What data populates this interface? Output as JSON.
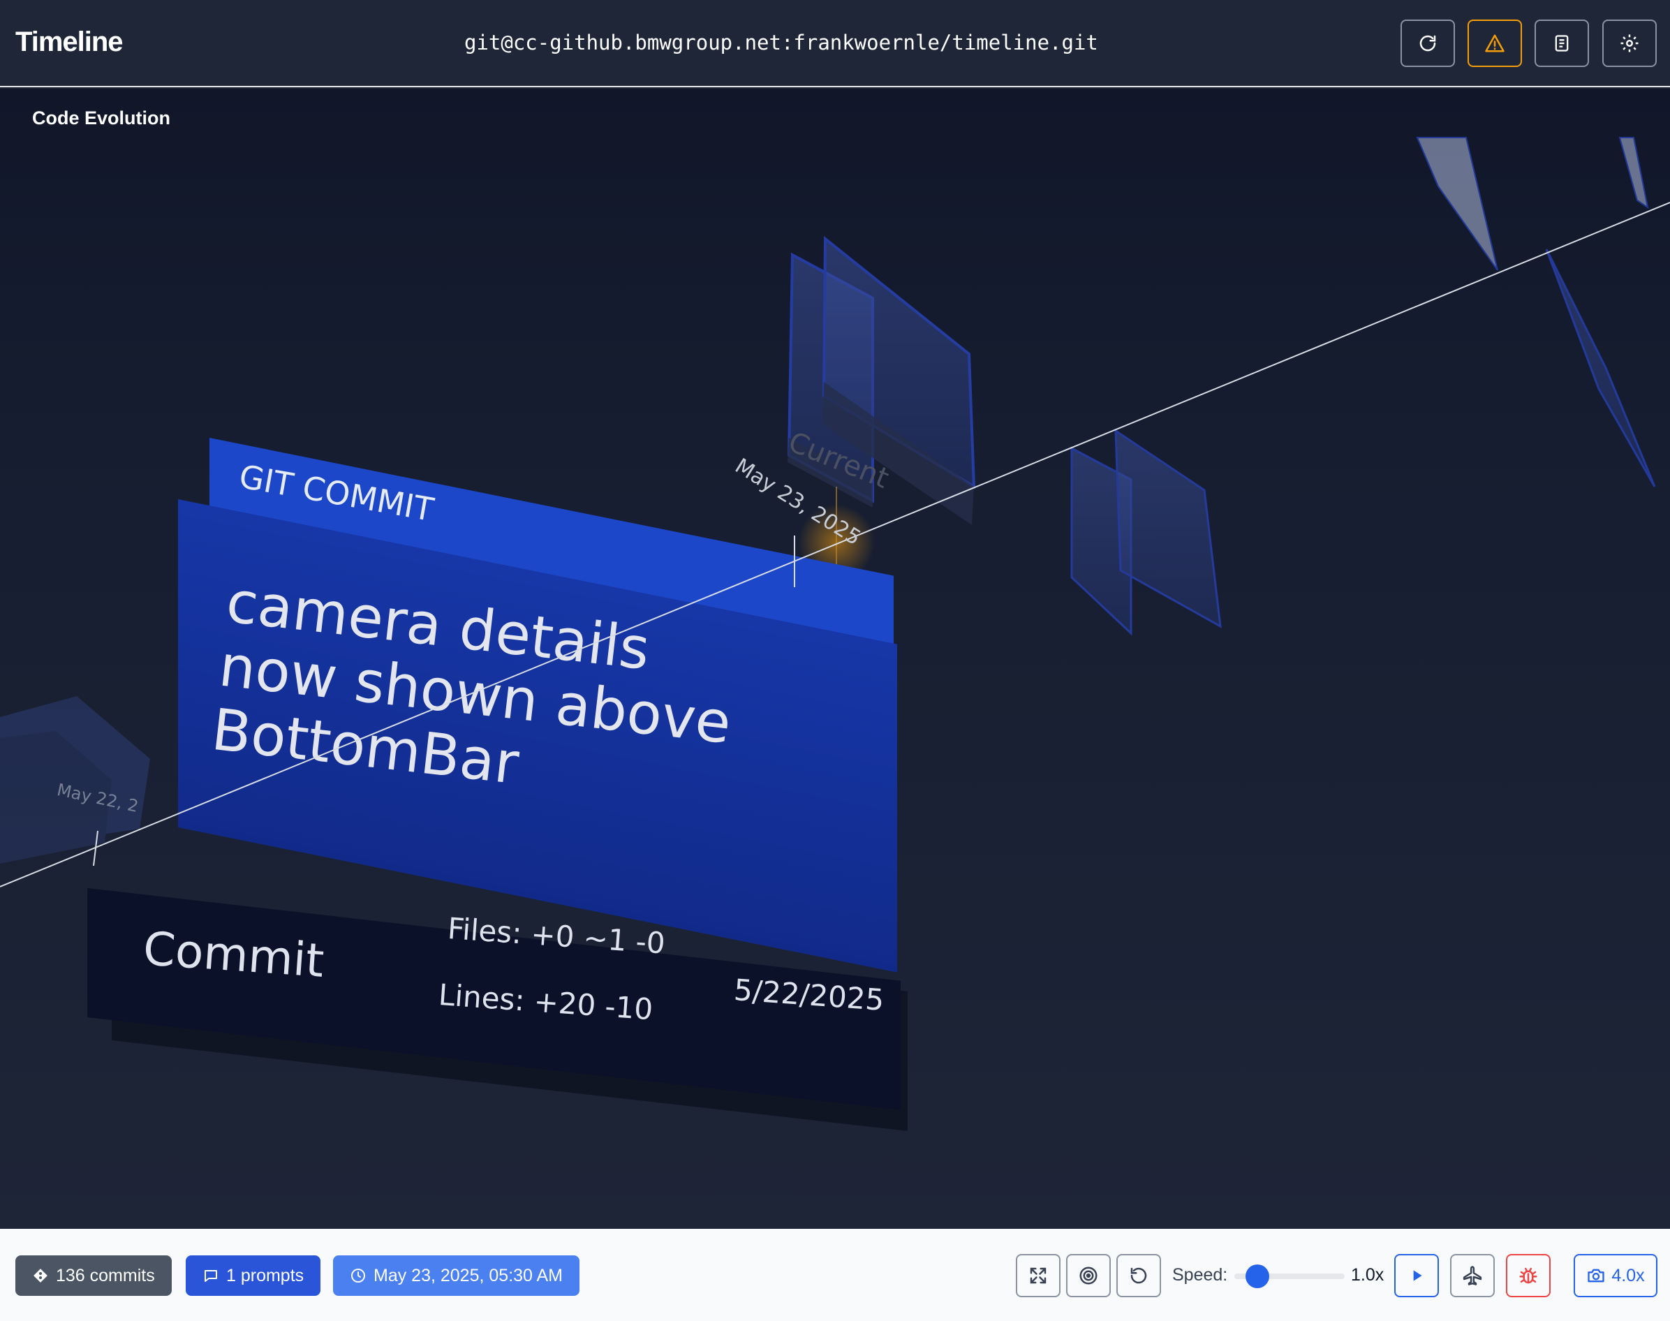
{
  "header": {
    "title": "Timeline",
    "repo_url": "git@cc-github.bmwgroup.net:frankwoernle/timeline.git",
    "buttons": [
      {
        "name": "refresh-icon"
      },
      {
        "name": "warning-icon",
        "color": "#f59e0b"
      },
      {
        "name": "document-icon"
      },
      {
        "name": "gear-icon"
      }
    ]
  },
  "scene": {
    "title": "Code Evolution",
    "current_label": "Current",
    "axis_dates": [
      "May 23, 2025",
      "May 22, 2"
    ],
    "focused_commit": {
      "label": "GIT COMMIT",
      "message": "camera details now shown above BottomBar",
      "type": "Commit",
      "files": "Files: +0 ~1 -0",
      "lines": "Lines: +20 -10",
      "date": "5/22/2025"
    },
    "accent_color": "#1d47c9"
  },
  "bottom_bar": {
    "commits_badge": "136 commits",
    "prompts_badge": "1 prompts",
    "time_badge": "May 23, 2025, 05:30 AM",
    "speed_label": "Speed:",
    "speed_value": "1.0x",
    "speed_slider_fraction": 0.18,
    "zoom_value": "4.0x",
    "controls": [
      "fullscreen-icon",
      "target-icon",
      "reset-icon",
      "play-icon",
      "airplane-icon",
      "bug-icon",
      "camera-icon"
    ]
  }
}
